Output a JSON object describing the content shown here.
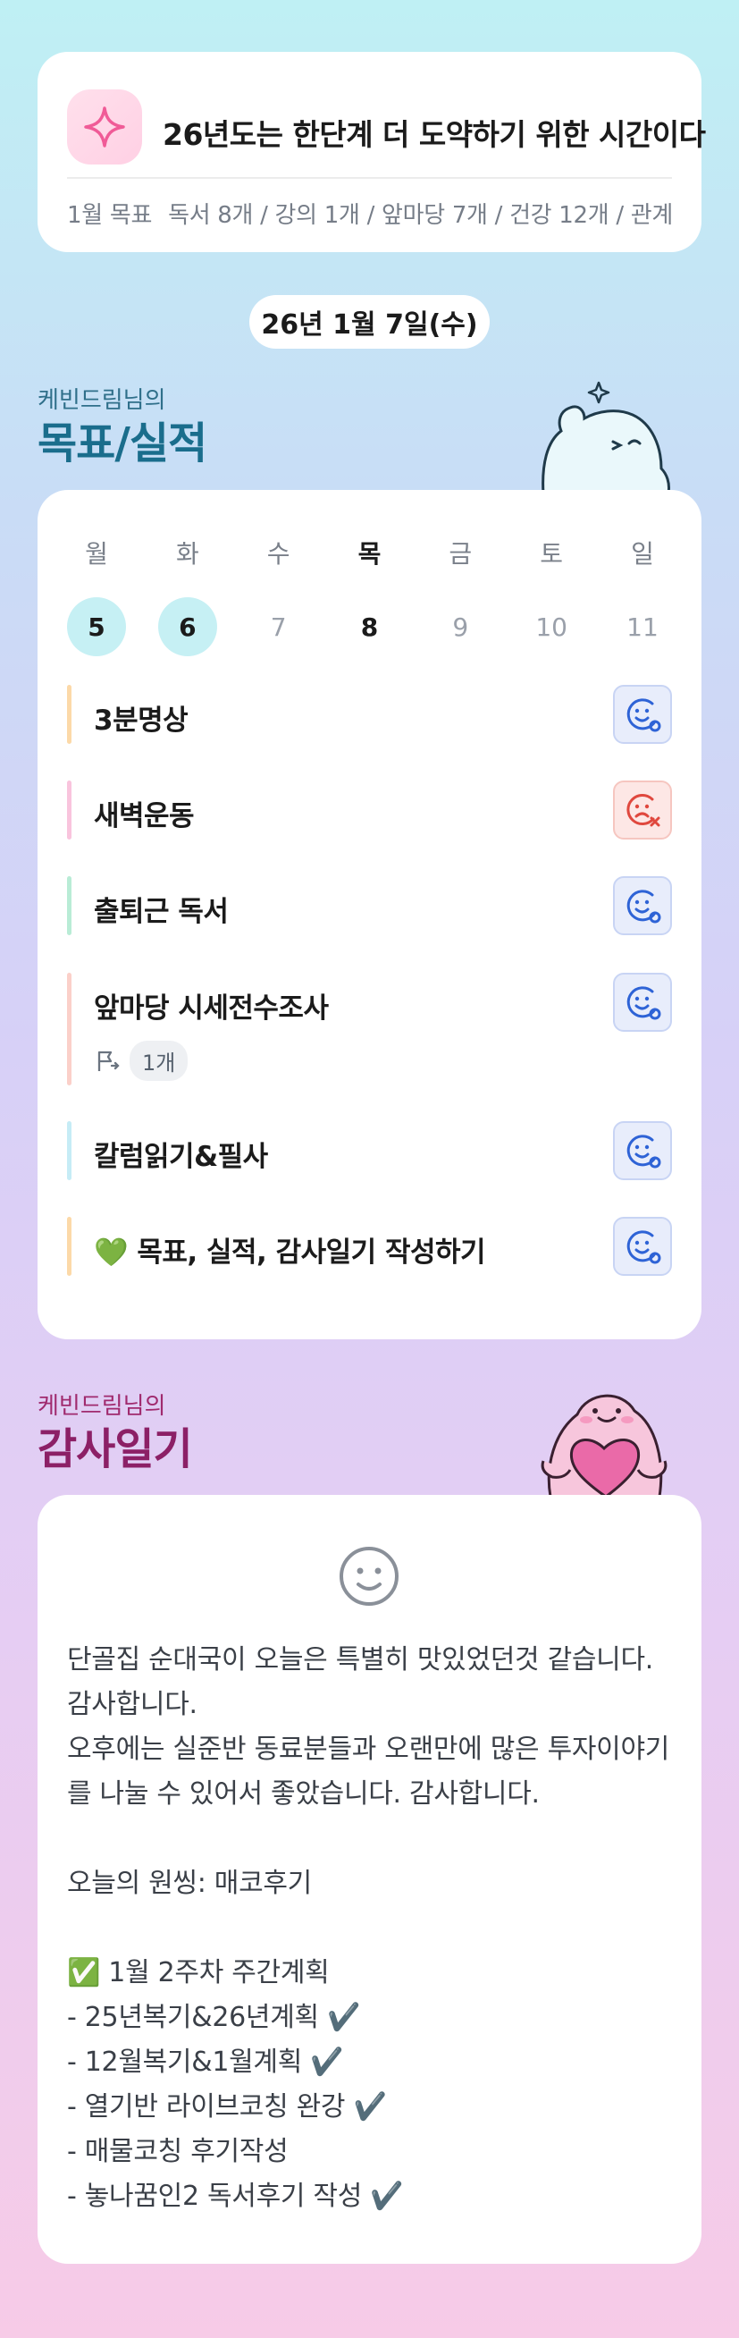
{
  "goal_card": {
    "title": "26년도는 한단계 더 도약하기 위한 시간이다",
    "month_label": "1월 목표",
    "summary": "독서 8개 / 강의 1개 / 앞마당 7개 / 건강 12개 / 관계"
  },
  "date": "26년 1월 7일(수)",
  "goals_section": {
    "owner_label": "케빈드림님의",
    "title": "목표/실적"
  },
  "week": {
    "days": [
      "월",
      "화",
      "수",
      "목",
      "금",
      "토",
      "일"
    ],
    "dates": [
      "5",
      "6",
      "7",
      "8",
      "9",
      "10",
      "11"
    ]
  },
  "tasks": [
    {
      "name": "3분명상",
      "status": "done",
      "bar_color": "#fcd9a8"
    },
    {
      "name": "새벽운동",
      "status": "missed",
      "bar_color": "#f9c4dd"
    },
    {
      "name": "출퇴근 독서",
      "status": "done",
      "bar_color": "#b9ecd6"
    },
    {
      "name": "앞마당 시세전수조사",
      "status": "done",
      "bar_color": "#fbd0c9",
      "sub_count": "1개"
    },
    {
      "name": "칼럼읽기&필사",
      "status": "done",
      "bar_color": "#c6ecf6"
    },
    {
      "name": "💚 목표, 실적, 감사일기 작성하기",
      "status": "done",
      "bar_color": "#fcd9a8"
    }
  ],
  "thanks_section": {
    "owner_label": "케빈드림님의",
    "title": "감사일기"
  },
  "journal": {
    "p1": "단골집 순대국이 오늘은 특별히 맛있었던것 같습니다. 감사합니다.",
    "p2": "오후에는 실준반 동료분들과 오랜만에 많은 투자이야기를 나눌 수 있어서 좋았습니다. 감사합니다.",
    "p3": "오늘의 원씽: 매코후기",
    "p4": "✅ 1월 2주차 주간계획",
    "p5": "- 25년복기&26년계획 ✔️",
    "p6": "- 12월복기&1월계획 ✔️",
    "p7": "- 열기반 라이브코칭 완강 ✔️",
    "p8": "- 매물코칭 후기작성",
    "p9": "- 놓나꿈인2 독서후기 작성 ✔️"
  },
  "colors": {
    "accent_teal": "#1a6d8c",
    "accent_pink": "#8c2066",
    "done_blue": "#2e63d6",
    "missed_red": "#e0483e"
  }
}
